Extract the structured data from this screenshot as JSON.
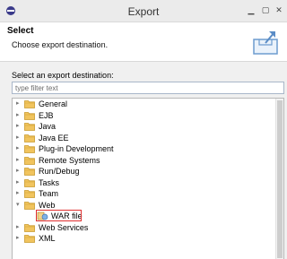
{
  "window": {
    "title": "Export"
  },
  "header": {
    "title": "Select",
    "description": "Choose export destination."
  },
  "prompt": "Select an export destination:",
  "filter": {
    "placeholder": "type filter text",
    "value": ""
  },
  "tree": {
    "items": [
      {
        "label": "General",
        "type": "folder",
        "level": 0
      },
      {
        "label": "EJB",
        "type": "folder",
        "level": 0
      },
      {
        "label": "Java",
        "type": "folder",
        "level": 0
      },
      {
        "label": "Java EE",
        "type": "folder",
        "level": 0
      },
      {
        "label": "Plug-in Development",
        "type": "folder",
        "level": 0
      },
      {
        "label": "Remote Systems",
        "type": "folder",
        "level": 0
      },
      {
        "label": "Run/Debug",
        "type": "folder",
        "level": 0
      },
      {
        "label": "Tasks",
        "type": "folder",
        "level": 0
      },
      {
        "label": "Team",
        "type": "folder",
        "level": 0
      },
      {
        "label": "Web",
        "type": "folder-open",
        "level": 0
      },
      {
        "label": "WAR file",
        "type": "war-file",
        "level": 1,
        "selected": true
      },
      {
        "label": "Web Services",
        "type": "folder",
        "level": 0
      },
      {
        "label": "XML",
        "type": "folder",
        "level": 0
      }
    ]
  },
  "colors": {
    "highlight": "#e03030",
    "folder": "#e8b84a"
  }
}
